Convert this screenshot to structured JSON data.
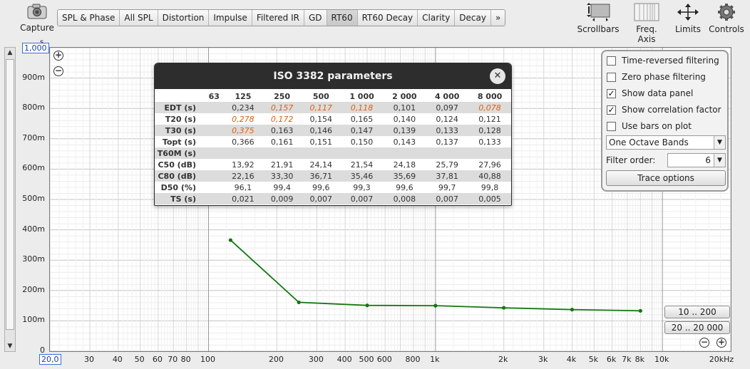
{
  "toolbar": {
    "capture_label": "Capture",
    "tabs": [
      "SPL & Phase",
      "All SPL",
      "Distortion",
      "Impulse",
      "Filtered IR",
      "GD",
      "RT60",
      "RT60 Decay",
      "Clarity",
      "Decay",
      "»"
    ],
    "active_tab": "RT60",
    "tools": [
      {
        "label": "Scrollbars",
        "icon": "scrollbars-icon"
      },
      {
        "label": "Freq. Axis",
        "icon": "freq-axis-icon"
      },
      {
        "label": "Limits",
        "icon": "limits-icon"
      },
      {
        "label": "Controls",
        "icon": "gear-icon"
      }
    ]
  },
  "plot": {
    "y_unit": "s",
    "y_max_box": "1,000",
    "x_min_box": "20,0",
    "y_ticks": [
      "900m",
      "800m",
      "700m",
      "600m",
      "500m",
      "400m",
      "300m",
      "200m",
      "100m",
      "0"
    ],
    "x_ticks": [
      "30",
      "40",
      "50",
      "60",
      "70",
      "80",
      "100",
      "200",
      "300",
      "400",
      "500",
      "600",
      "800",
      "1k",
      "2k",
      "3k",
      "4k",
      "5k",
      "6k",
      "7k",
      "8k",
      "10k",
      "20kHz"
    ],
    "line_color": "#117711"
  },
  "chart_data": {
    "type": "line",
    "x_scale": "log",
    "xlim": [
      20,
      20000
    ],
    "ylim": [
      0,
      1.0
    ],
    "ylabel": "s",
    "series": [
      {
        "x": [
          125,
          250,
          500,
          1000,
          2000,
          4000,
          8000
        ],
        "y": [
          0.366,
          0.161,
          0.151,
          0.15,
          0.143,
          0.137,
          0.133
        ]
      }
    ]
  },
  "dialog": {
    "title": "ISO 3382 parameters",
    "columns": [
      "63",
      "125",
      "250",
      "500",
      "1 000",
      "2 000",
      "4 000",
      "8 000"
    ],
    "rows": [
      {
        "label": "EDT (s)",
        "cells": [
          "",
          "0,234",
          "0,157",
          "0,117",
          "0,118",
          "0,101",
          "0,097",
          "0,078"
        ],
        "warn": [
          2,
          3,
          4,
          7
        ]
      },
      {
        "label": "T20 (s)",
        "cells": [
          "",
          "0,278",
          "0,172",
          "0,154",
          "0,165",
          "0,140",
          "0,124",
          "0,121"
        ],
        "warn": [
          1,
          2
        ]
      },
      {
        "label": "T30 (s)",
        "cells": [
          "",
          "0,375",
          "0,163",
          "0,146",
          "0,147",
          "0,139",
          "0,133",
          "0,128"
        ],
        "warn": [
          1
        ]
      },
      {
        "label": "Topt (s)",
        "cells": [
          "",
          "0,366",
          "0,161",
          "0,151",
          "0,150",
          "0,143",
          "0,137",
          "0,133"
        ],
        "warn": []
      },
      {
        "label": "T60M (s)",
        "cells": [
          "",
          "",
          "",
          "",
          "",
          "",
          "",
          ""
        ],
        "warn": []
      },
      {
        "label": "C50 (dB)",
        "cells": [
          "",
          "13,92",
          "21,91",
          "24,14",
          "21,54",
          "24,18",
          "25,79",
          "27,96"
        ],
        "warn": []
      },
      {
        "label": "C80 (dB)",
        "cells": [
          "",
          "22,16",
          "33,30",
          "36,71",
          "35,46",
          "35,69",
          "37,81",
          "40,88"
        ],
        "warn": []
      },
      {
        "label": "D50 (%)",
        "cells": [
          "",
          "96,1",
          "99,4",
          "99,6",
          "99,3",
          "99,6",
          "99,7",
          "99,8"
        ],
        "warn": []
      },
      {
        "label": "TS (s)",
        "cells": [
          "",
          "0,021",
          "0,009",
          "0,007",
          "0,007",
          "0,008",
          "0,007",
          "0,005"
        ],
        "warn": []
      }
    ],
    "warn_color": "#e06010"
  },
  "panel": {
    "checkboxes": [
      {
        "label": "Time-reversed filtering",
        "checked": false
      },
      {
        "label": "Zero phase filtering",
        "checked": false
      },
      {
        "label": "Show data panel",
        "checked": true
      },
      {
        "label": "Show correlation factor",
        "checked": true
      },
      {
        "label": "Use bars on plot",
        "checked": false
      }
    ],
    "band_select": "One Octave Bands",
    "filter_order_label": "Filter order:",
    "filter_order_value": "6",
    "trace_options": "Trace options"
  },
  "range_buttons": [
    "10 .. 200",
    "20 .. 20 000"
  ]
}
